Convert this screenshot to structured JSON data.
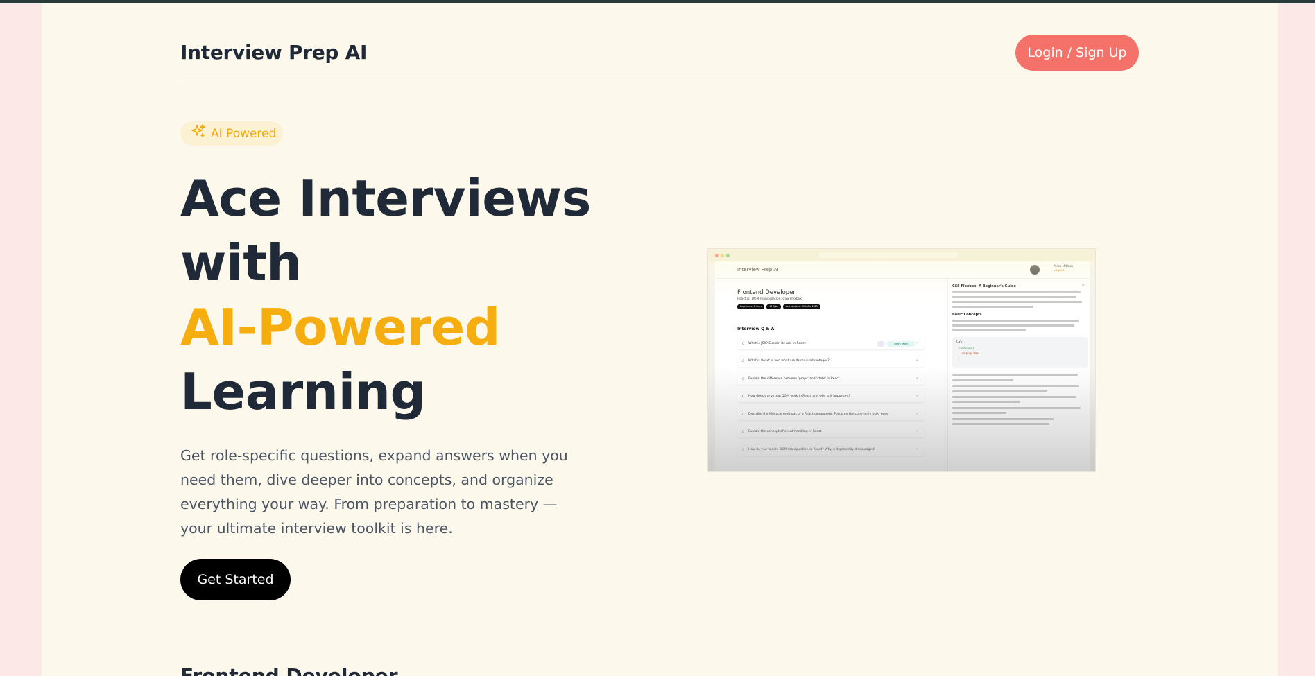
{
  "header": {
    "brand": "Interview Prep AI",
    "login_label": "Login / Sign Up"
  },
  "hero": {
    "badge_label": "AI Powered",
    "title_line1": "Ace Interviews",
    "title_line2": "with",
    "title_accent": "AI-Powered",
    "title_line4": "Learning",
    "description": "Get role-specific questions, expand answers when you need them, dive deeper into concepts, and organize everything your way. From preparation to mastery — your ultimate interview toolkit is here.",
    "cta_label": "Get Started"
  },
  "next_section": {
    "title": "Frontend Developer"
  },
  "colors": {
    "accent": "#f6ad10",
    "login_button": "#f4726a",
    "page_background": "#fdf8ec",
    "outer_background": "#fde8e8",
    "text_dark": "#1f2937"
  },
  "preview": {
    "brand": "Interview Prep AI",
    "user_name": "Akku Mithun",
    "user_action": "Logout",
    "role": "Frontend Developer",
    "topics": "React.js, DOM manipulation, CSS Flexbox",
    "tags": [
      "Experience: 2 Years",
      "10 Q&A",
      "Last Updated: 30th Apr 2025"
    ],
    "qa_heading": "Interview Q & A",
    "learn_more": "Learn More",
    "questions": [
      "What is JSX? Explain its role in React.",
      "What is React.js and what are its main advantages?",
      "Explain the difference between 'props' and 'state' in React.",
      "How does the virtual DOM work in React and why is it important?",
      "Describe the lifecycle methods of a React component. Focus on the commonly used ones.",
      "Explain the concept of event handling in React.",
      "How do you handle DOM manipulation in React? Why is it generally discouraged?"
    ],
    "drawer_title": "CSS Flexbox: A Beginner's Guide",
    "drawer_section": "Basic Concepts",
    "code_lang": "CSS",
    "code_line1": ".container {",
    "code_line2": "display: flex;",
    "code_line3": "}"
  }
}
